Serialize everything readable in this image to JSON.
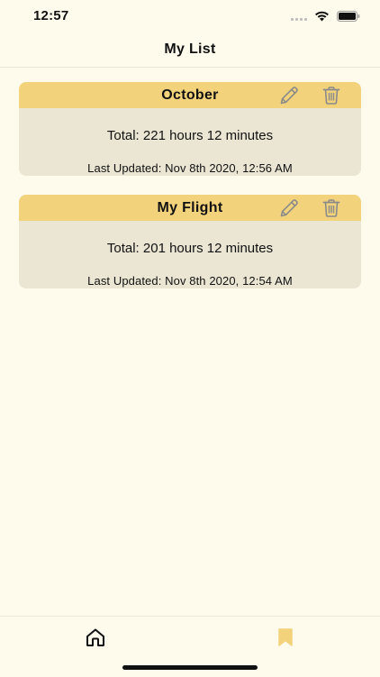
{
  "status_bar": {
    "time": "12:57"
  },
  "nav": {
    "title": "My List"
  },
  "cards": [
    {
      "title": "October",
      "total": "Total: 221 hours 12 minutes",
      "last_updated": "Last Updated: Nov 8th 2020, 12:56 AM"
    },
    {
      "title": "My Flight",
      "total": "Total: 201 hours 12 minutes",
      "last_updated": "Last Updated: Nov 8th 2020, 12:54 AM"
    }
  ],
  "icons": {
    "edit": "pencil-icon",
    "delete": "trash-icon",
    "home": "home-icon",
    "saved": "bookmark-icon"
  },
  "colors": {
    "background": "#fefaec",
    "card_header": "#f2d37c",
    "card_body": "#ebe6d4",
    "icon_gray": "#8a8a8a",
    "tab_active": "#f2d37c"
  }
}
